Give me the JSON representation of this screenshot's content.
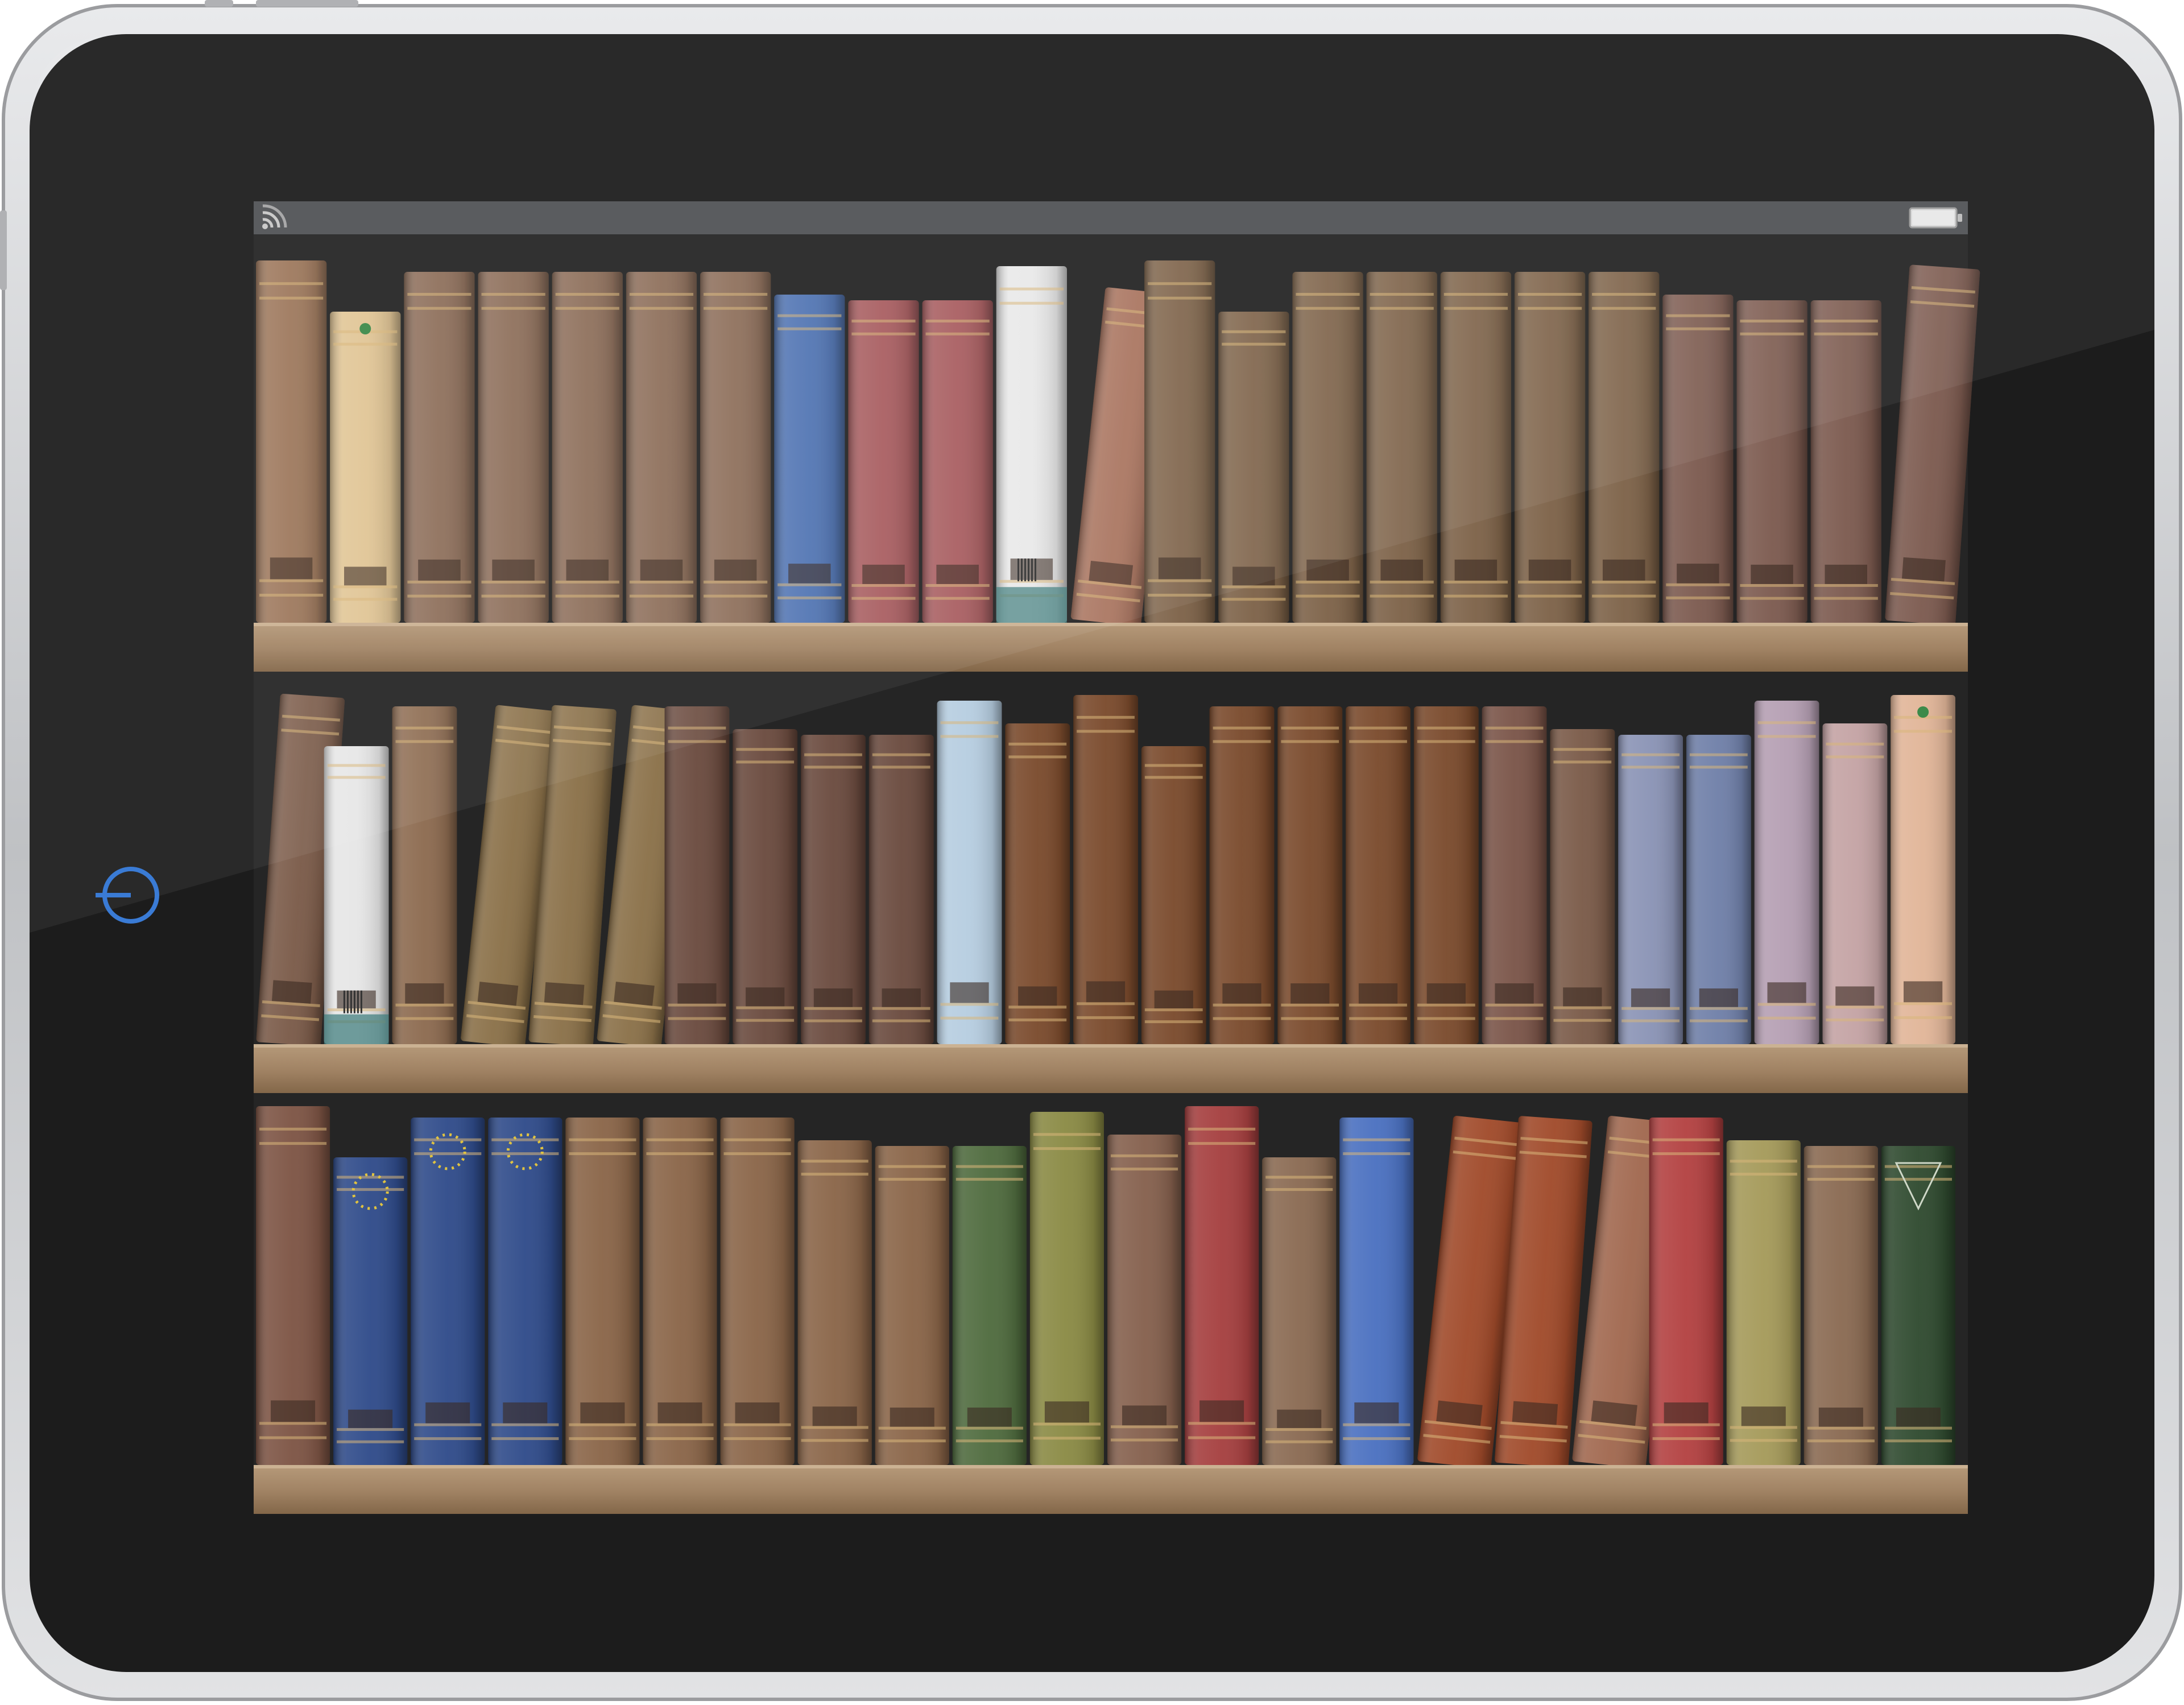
{
  "device": {
    "kind": "tablet",
    "bezel_color": "#1c1c1c",
    "frame_color": "#cfd0d2",
    "screen_color": "#252525",
    "status_bar_color": "#505255",
    "home_button_color": "#3a7bd5",
    "shelf_color": "#a8896a"
  },
  "status_bar": {
    "left_icon": "wifi-icon",
    "right_icon": "battery-icon"
  },
  "bookshelf": {
    "shelf_count": 3,
    "shelves": [
      {
        "books": [
          {
            "color": "#9a7356"
          },
          {
            "color": "#e0c391",
            "ornament": "star"
          },
          {
            "color": "#8a6a55"
          },
          {
            "color": "#8a6a55"
          },
          {
            "color": "#8a6a55"
          },
          {
            "color": "#8a6a55"
          },
          {
            "color": "#8a6a55"
          },
          {
            "color": "#4a6fb0"
          },
          {
            "color": "#a5575a"
          },
          {
            "color": "#a5575a"
          },
          {
            "color": "#e8e8e8",
            "ornament": "barcode"
          },
          {
            "color": "#a7705a",
            "tilt": true
          },
          {
            "color": "#7d6248"
          },
          {
            "color": "#7d6248"
          },
          {
            "color": "#7d6248"
          },
          {
            "color": "#7d6248"
          },
          {
            "color": "#7d6248"
          },
          {
            "color": "#7d6248"
          },
          {
            "color": "#7d6248"
          },
          {
            "color": "#7c5a4f"
          },
          {
            "color": "#7c5a4f"
          },
          {
            "color": "#7c5a4f"
          },
          {
            "color": "#7c5a4f",
            "tilt": true
          }
        ]
      },
      {
        "books": [
          {
            "color": "#7a5a48",
            "tilt": true
          },
          {
            "color": "#e6e6e6",
            "ornament": "barcode"
          },
          {
            "color": "#8c6a4f"
          },
          {
            "color": "#8a7048",
            "tilt": true
          },
          {
            "color": "#8a7048",
            "tilt": true
          },
          {
            "color": "#8a7048",
            "tilt": true
          },
          {
            "color": "#6a4a3e"
          },
          {
            "color": "#6a4a3e"
          },
          {
            "color": "#6a4a3e"
          },
          {
            "color": "#6a4a3e"
          },
          {
            "color": "#b6cde0"
          },
          {
            "color": "#7a4a2c"
          },
          {
            "color": "#7a4a2c"
          },
          {
            "color": "#7a4a2c"
          },
          {
            "color": "#7a4a2c"
          },
          {
            "color": "#7a4a2c"
          },
          {
            "color": "#7a4a2c"
          },
          {
            "color": "#7a4a2c"
          },
          {
            "color": "#7a5448"
          },
          {
            "color": "#7a5a48"
          },
          {
            "color": "#8a93b5"
          },
          {
            "color": "#6f7fa8"
          },
          {
            "color": "#b59fb3"
          },
          {
            "color": "#c4a3a4"
          },
          {
            "color": "#e1b598",
            "ornament": "star"
          }
        ]
      },
      {
        "books": [
          {
            "color": "#7d5444"
          },
          {
            "color": "#2f4b8a",
            "ornament": "stars"
          },
          {
            "color": "#2f4b8a",
            "ornament": "stars"
          },
          {
            "color": "#2f4b8a",
            "ornament": "stars"
          },
          {
            "color": "#8a6548"
          },
          {
            "color": "#8a6548"
          },
          {
            "color": "#8a6548"
          },
          {
            "color": "#8a6548"
          },
          {
            "color": "#8a6548"
          },
          {
            "color": "#4f6b3e"
          },
          {
            "color": "#8a8a44"
          },
          {
            "color": "#85604d"
          },
          {
            "color": "#a53f3f"
          },
          {
            "color": "#8a6a52"
          },
          {
            "color": "#4a70c0"
          },
          {
            "color": "#a04a2a",
            "tilt": true
          },
          {
            "color": "#a04a2a",
            "tilt": true
          },
          {
            "color": "#a1684f",
            "tilt": true
          },
          {
            "color": "#b34141"
          },
          {
            "color": "#a59a5a"
          },
          {
            "color": "#8a6a52"
          },
          {
            "color": "#2f4a2f",
            "ornament": "lattice"
          }
        ]
      }
    ]
  }
}
